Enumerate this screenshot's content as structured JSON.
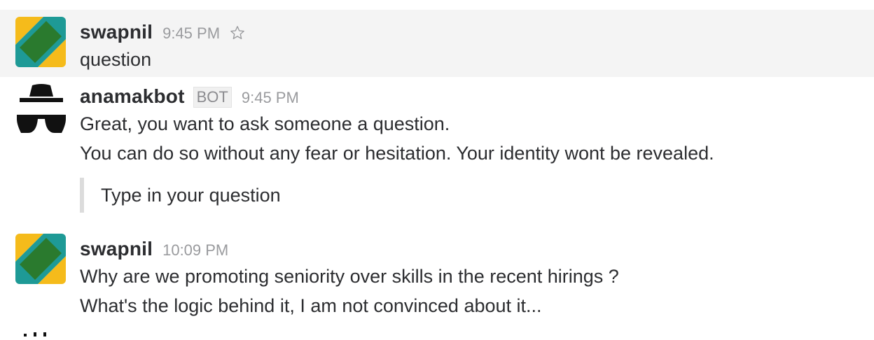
{
  "messages": [
    {
      "author": "swapnil",
      "time": "9:45 PM",
      "lines": [
        "question"
      ],
      "avatar_icon": "colorful-geometric-avatar-icon",
      "star_icon": "star-outline-icon"
    },
    {
      "author": "anamakbot",
      "badge": "BOT",
      "time": "9:45 PM",
      "lines": [
        "Great, you want to ask someone a question.",
        "You can do so without any fear or hesitation. Your identity wont be revealed."
      ],
      "attachment": "Type in your question",
      "avatar_icon": "incognito-spy-icon"
    },
    {
      "author": "swapnil",
      "time": "10:09 PM",
      "lines": [
        "Why are we promoting seniority over skills in the recent hirings ?",
        "What's the logic behind it, I am not convinced about it..."
      ],
      "avatar_icon": "colorful-geometric-avatar-icon"
    }
  ],
  "colors": {
    "hover_background": "#f4f4f4",
    "text": "#2c2d30",
    "timestamp": "#9a9b9e",
    "quote_bar": "#dcdcdc",
    "avatar_yellow": "#f5bb1b",
    "avatar_green": "#2a7a2e",
    "avatar_teal": "#1e9a96"
  }
}
